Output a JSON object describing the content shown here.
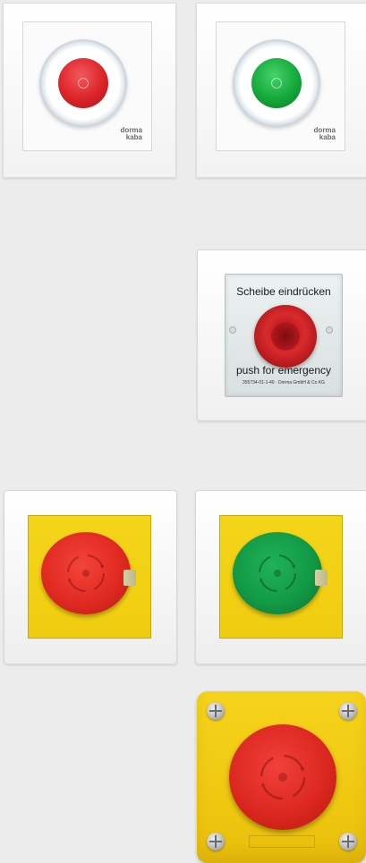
{
  "row1": {
    "tiles": [
      {
        "button_color": "red",
        "brand_line1": "dorma",
        "brand_line2": "kaba"
      },
      {
        "button_color": "green",
        "brand_line1": "dorma",
        "brand_line2": "kaba"
      }
    ]
  },
  "row2": {
    "cover_text_top": "Scheibe eindrücken",
    "cover_text_bottom": "push for emergency",
    "cover_code": "355734-01-1-40 · Dorma GmbH & Co KG"
  },
  "row3": {
    "tiles": [
      {
        "button_color": "red"
      },
      {
        "button_color": "green"
      }
    ]
  },
  "row4": {
    "enclosure_color": "yellow",
    "button_color": "red"
  },
  "colors": {
    "background": "#ececec",
    "red": "#dc2328",
    "green": "#14a83a",
    "yellow": "#f2cf14"
  }
}
